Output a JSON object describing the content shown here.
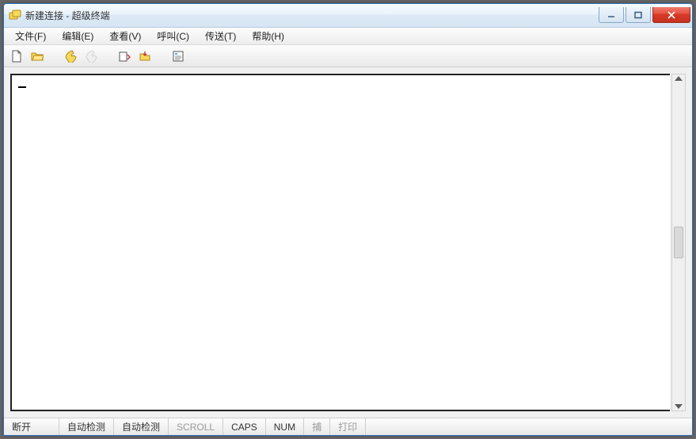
{
  "title": "新建连接 - 超级终端",
  "menu": {
    "file": "文件(F)",
    "edit": "编辑(E)",
    "view": "查看(V)",
    "call": "呼叫(C)",
    "transfer": "传送(T)",
    "help": "帮助(H)"
  },
  "toolbar_icons": {
    "new": "new-file-icon",
    "open": "open-folder-icon",
    "connect": "phone-connect-icon",
    "disconnect": "phone-disconnect-icon",
    "send": "send-file-icon",
    "receive": "receive-file-icon",
    "properties": "properties-icon"
  },
  "terminal_content": "",
  "status": {
    "connection": "断开",
    "auto_detect_1": "自动检测",
    "auto_detect_2": "自动检测",
    "scroll": "SCROLL",
    "caps": "CAPS",
    "num": "NUM",
    "capture": "捕",
    "print": "打印"
  }
}
